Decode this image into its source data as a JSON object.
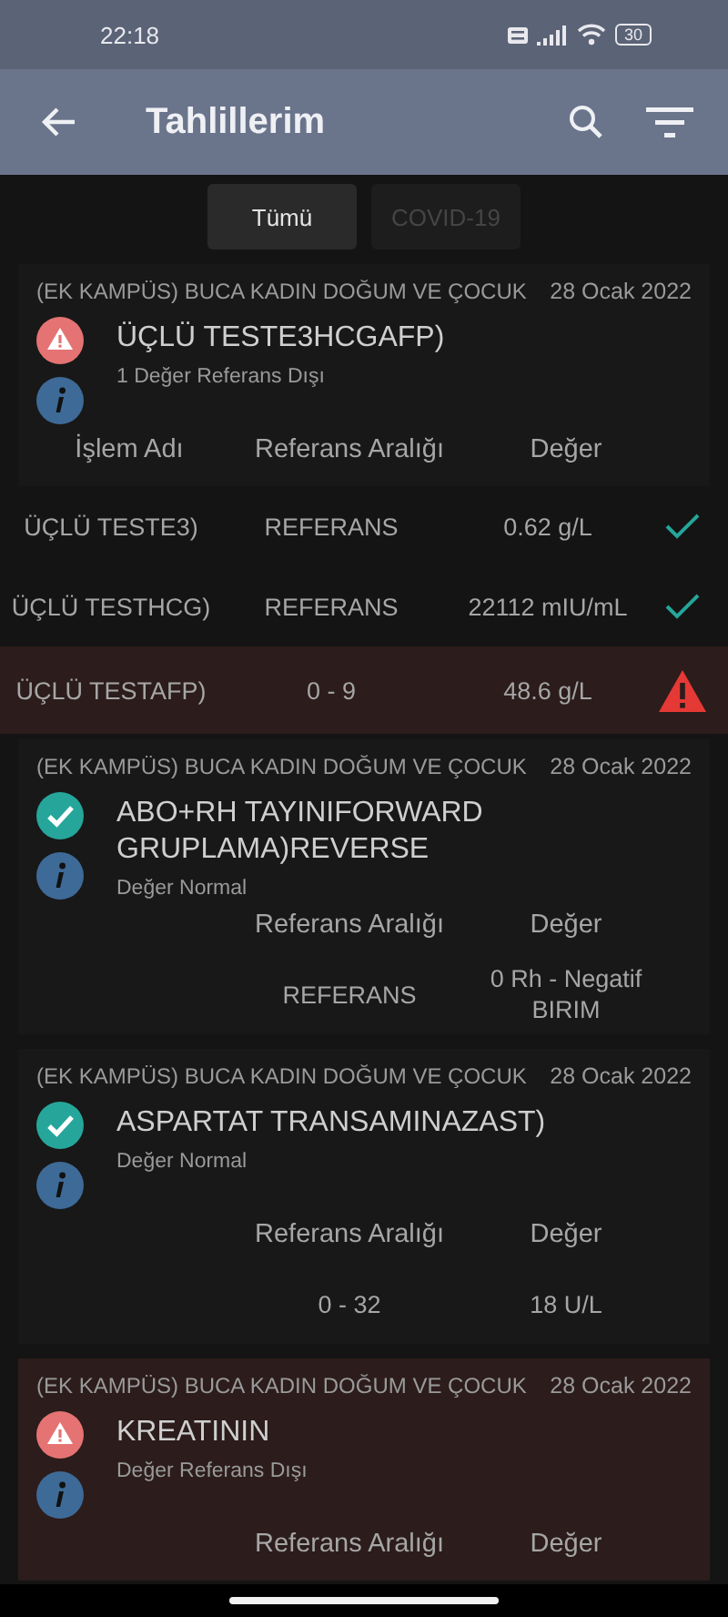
{
  "status_bar": {
    "time": "22:18",
    "battery": "30"
  },
  "app_bar": {
    "title": "Tahlillerim"
  },
  "tabs": [
    {
      "label": "Tümü",
      "selected": true
    },
    {
      "label": "COVID-19",
      "selected": false
    }
  ],
  "results": [
    {
      "kind": "grouped",
      "highlighted": false,
      "hospital": "(EK KAMPÜS) BUCA KADIN DOĞUM VE ÇOCUK",
      "date": "28 Ocak 2022",
      "out_of_range": true,
      "name": "ÜÇLÜ TESTE3HCGAFP)",
      "summary": "1 Değer Referans Dışı",
      "columns": [
        "İşlem Adı",
        "Referans Aralığı",
        "Değer"
      ],
      "rows": [
        {
          "name": "ÜÇLÜ TESTE3)",
          "reference": "REFERANS",
          "value": "0.62 g/L",
          "out_of_range": false
        },
        {
          "name": "ÜÇLÜ TESTHCG)",
          "reference": "REFERANS",
          "value": "22112 mIU/mL",
          "out_of_range": false
        },
        {
          "name": "ÜÇLÜ TESTAFP)",
          "reference": "0 - 9",
          "value": "48.6 g/L",
          "out_of_range": true
        }
      ]
    },
    {
      "kind": "card",
      "highlighted": false,
      "hospital": "(EK KAMPÜS) BUCA KADIN DOĞUM VE ÇOCUK",
      "date": "28 Ocak 2022",
      "out_of_range": false,
      "name": "ABO+RH TAYINIFORWARD GRUPLAMA)REVERSE",
      "summary": "Değer Normal",
      "columns": [
        "Referans Aralığı",
        "Değer"
      ],
      "rows": [
        {
          "reference": "REFERANS",
          "value": "0 Rh - Negatif\nBIRIM"
        }
      ]
    },
    {
      "kind": "card",
      "highlighted": false,
      "hospital": "(EK KAMPÜS) BUCA KADIN DOĞUM VE ÇOCUK",
      "date": "28 Ocak 2022",
      "out_of_range": false,
      "name": "ASPARTAT TRANSAMINAZAST)",
      "summary": "Değer Normal",
      "columns": [
        "Referans Aralığı",
        "Değer"
      ],
      "rows": [
        {
          "reference": "0 - 32",
          "value": "18 U/L"
        }
      ]
    },
    {
      "kind": "card",
      "highlighted": true,
      "hospital": "(EK KAMPÜS) BUCA KADIN DOĞUM VE ÇOCUK",
      "date": "28 Ocak 2022",
      "out_of_range": true,
      "name": "KREATININ",
      "summary": "Değer Referans Dışı",
      "columns": [
        "Referans Aralığı",
        "Değer"
      ]
    }
  ]
}
